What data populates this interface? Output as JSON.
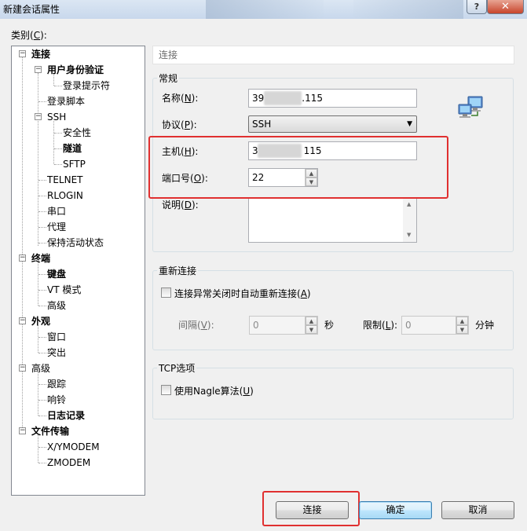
{
  "window": {
    "title": "新建会话属性",
    "help_label": "?",
    "close_label": "✕"
  },
  "category": {
    "label": "类别(C):",
    "label_main": "类别(",
    "label_key": "C",
    "label_tail": "):"
  },
  "tree": [
    {
      "label": "连接",
      "bold": true,
      "expander": "−"
    },
    {
      "label": "用户身份验证",
      "bold": true,
      "expander": "−"
    },
    {
      "label": "登录提示符",
      "bold": false,
      "expander": ""
    },
    {
      "label": "登录脚本",
      "bold": false,
      "expander": ""
    },
    {
      "label": "SSH",
      "bold": false,
      "expander": "−"
    },
    {
      "label": "安全性",
      "bold": false,
      "expander": ""
    },
    {
      "label": "隧道",
      "bold": true,
      "expander": ""
    },
    {
      "label": "SFTP",
      "bold": false,
      "expander": ""
    },
    {
      "label": "TELNET",
      "bold": false,
      "expander": ""
    },
    {
      "label": "RLOGIN",
      "bold": false,
      "expander": ""
    },
    {
      "label": "串口",
      "bold": false,
      "expander": ""
    },
    {
      "label": "代理",
      "bold": false,
      "expander": ""
    },
    {
      "label": "保持活动状态",
      "bold": false,
      "expander": ""
    },
    {
      "label": "终端",
      "bold": true,
      "expander": "−"
    },
    {
      "label": "键盘",
      "bold": true,
      "expander": ""
    },
    {
      "label": "VT 模式",
      "bold": false,
      "expander": ""
    },
    {
      "label": "高级",
      "bold": false,
      "expander": ""
    },
    {
      "label": "外观",
      "bold": true,
      "expander": "−"
    },
    {
      "label": "窗口",
      "bold": false,
      "expander": ""
    },
    {
      "label": "突出",
      "bold": false,
      "expander": ""
    },
    {
      "label": "高级",
      "bold": false,
      "expander": "−"
    },
    {
      "label": "跟踪",
      "bold": false,
      "expander": ""
    },
    {
      "label": "响铃",
      "bold": false,
      "expander": ""
    },
    {
      "label": "日志记录",
      "bold": true,
      "expander": ""
    },
    {
      "label": "文件传输",
      "bold": true,
      "expander": "−"
    },
    {
      "label": "X/YMODEM",
      "bold": false,
      "expander": ""
    },
    {
      "label": "ZMODEM",
      "bold": false,
      "expander": ""
    }
  ],
  "breadcrumb": "连接",
  "general": {
    "title": "常规",
    "name_label_main": "名称(",
    "name_key": "N",
    "name_tail": "):",
    "name_value_prefix": "39",
    "name_value_suffix": ".115",
    "protocol_label_main": "协议(",
    "protocol_key": "P",
    "protocol_tail": "):",
    "protocol_value": "SSH",
    "host_label_main": "主机(",
    "host_key": "H",
    "host_tail": "):",
    "host_value_prefix": "3",
    "host_value_suffix": "115",
    "port_label_main": "端口号(",
    "port_key": "O",
    "port_tail": "):",
    "port_value": "22",
    "desc_label_main": "说明(",
    "desc_key": "D",
    "desc_tail": "):"
  },
  "reconnect": {
    "title": "重新连接",
    "checkbox_label_main": "连接异常关闭时自动重新连接(",
    "checkbox_key": "A",
    "checkbox_tail": ")",
    "interval_label_main": "间隔(",
    "interval_key": "V",
    "interval_tail": "):",
    "interval_value": "0",
    "interval_unit": "秒",
    "limit_label_main": "限制(",
    "limit_key": "L",
    "limit_tail": "):",
    "limit_value": "0",
    "limit_unit": "分钟"
  },
  "tcp": {
    "title": "TCP选项",
    "nagle_label_main": "使用Nagle算法(",
    "nagle_key": "U",
    "nagle_tail": ")"
  },
  "buttons": {
    "connect": "连接",
    "ok": "确定",
    "cancel": "取消"
  },
  "colors": {
    "highlight_box": "#e03030",
    "default_button_border": "#3c7fb1"
  }
}
